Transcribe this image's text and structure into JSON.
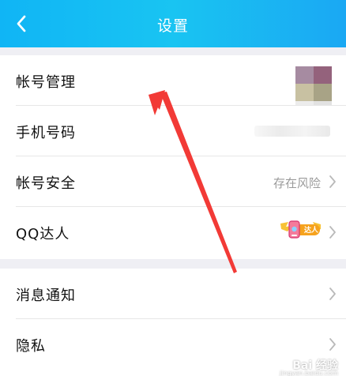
{
  "header": {
    "title": "设置",
    "back_icon": "chevron-left-icon",
    "background": "#13b9f4"
  },
  "section1": {
    "rows": [
      {
        "label": "帐号管理",
        "value": ""
      },
      {
        "label": "手机号码",
        "value": ""
      },
      {
        "label": "帐号安全",
        "value": "存在风险"
      },
      {
        "label": "QQ达人",
        "value": "",
        "badge_text": "达人"
      }
    ]
  },
  "section2": {
    "rows": [
      {
        "label": "消息通知"
      },
      {
        "label": "隐私"
      }
    ]
  },
  "colors": {
    "divider": "#e7e7e7",
    "arrow_annotation": "#f23a36",
    "value_gray": "#9a9a9a"
  },
  "watermark": {
    "text": "Bai 经验",
    "subtext": "jingyan.baidu.com"
  }
}
